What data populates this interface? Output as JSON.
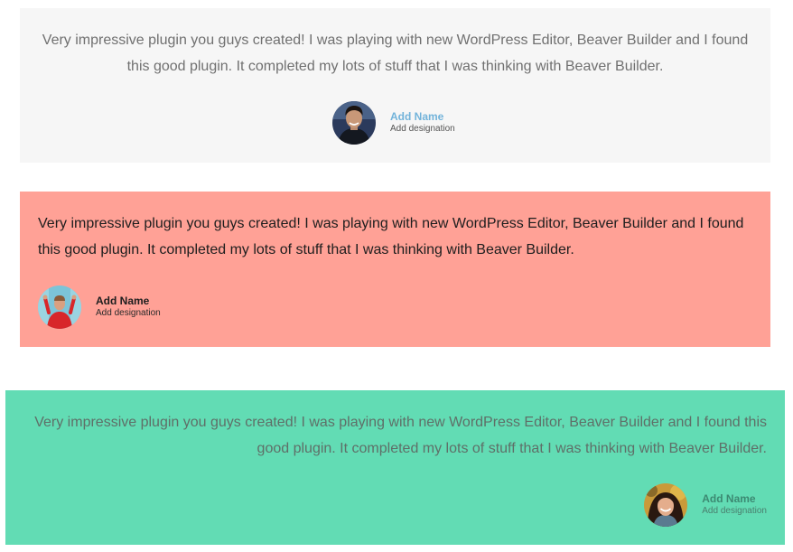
{
  "colors": {
    "card_1_bg": "#f6f6f6",
    "card_2_bg": "#ffa196",
    "card_3_bg": "#62dcb4",
    "card_1_name": "#72b3da"
  },
  "testimonials": [
    {
      "quote": "Very impressive plugin you guys created! I was playing with new WordPress Editor, Beaver Builder and I found this good plugin. It completed my lots of stuff that I was thinking with Beaver Builder.",
      "name": "Add Name",
      "designation": "Add designation",
      "avatar": "man-dark-jacket-avatar"
    },
    {
      "quote": "Very impressive plugin you guys created! I was playing with new WordPress Editor, Beaver Builder and I found this good plugin. It completed my lots of stuff that I was thinking with Beaver Builder.",
      "name": "Add Name",
      "designation": "Add designation",
      "avatar": "man-red-shirt-avatar"
    },
    {
      "quote": "Very impressive plugin you guys created! I was playing with new WordPress Editor, Beaver Builder and I found this good plugin. It completed my lots of stuff that I was thinking with Beaver Builder.",
      "name": "Add Name",
      "designation": "Add designation",
      "avatar": "woman-smiling-avatar"
    }
  ]
}
